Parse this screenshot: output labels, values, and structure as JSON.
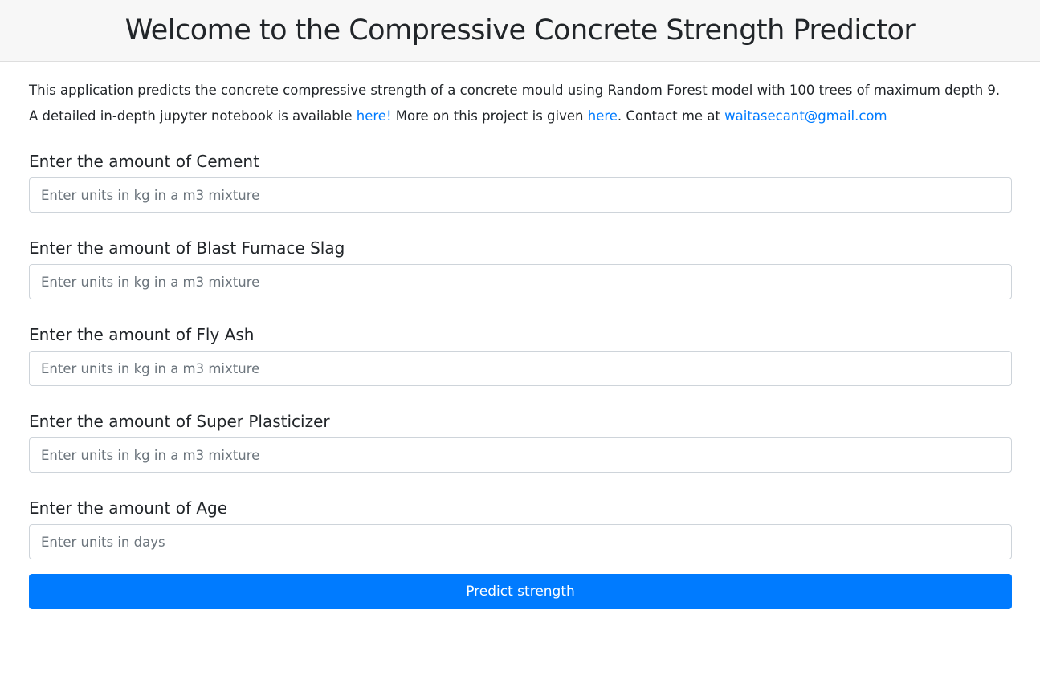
{
  "header": {
    "title": "Welcome to the Compressive Concrete Strength Predictor"
  },
  "intro": {
    "line1": "This application predicts the concrete compressive strength of a concrete mould using Random Forest model with 100 trees of maximum depth 9.",
    "line2_prefix": "A detailed in-depth jupyter notebook is available ",
    "notebook_link": "here!",
    "line2_middle": " More on this project is given ",
    "project_link": "here",
    "line2_contact": ". Contact me at ",
    "email_link": "waitasecant@gmail.com"
  },
  "form": {
    "fields": [
      {
        "label": "Enter the amount of Cement",
        "placeholder": "Enter units in kg in a m3 mixture",
        "value": ""
      },
      {
        "label": "Enter the amount of Blast Furnace Slag",
        "placeholder": "Enter units in kg in a m3 mixture",
        "value": ""
      },
      {
        "label": "Enter the amount of Fly Ash",
        "placeholder": "Enter units in kg in a m3 mixture",
        "value": ""
      },
      {
        "label": "Enter the amount of Super Plasticizer",
        "placeholder": "Enter units in kg in a m3 mixture",
        "value": ""
      },
      {
        "label": "Enter the amount of Age",
        "placeholder": "Enter units in days",
        "value": ""
      }
    ],
    "submit_label": "Predict strength"
  },
  "colors": {
    "accent": "#007bff",
    "header_bg": "#f7f7f7",
    "text": "#212529"
  }
}
